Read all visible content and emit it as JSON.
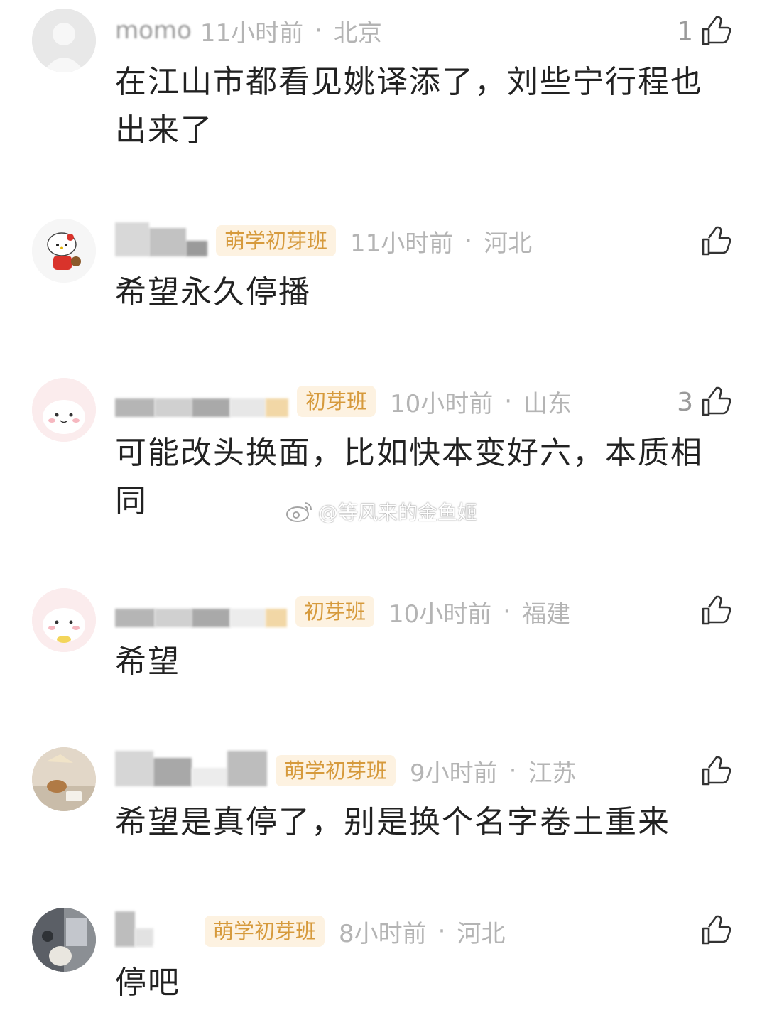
{
  "colors": {
    "badge_bg": "#fdf2e1",
    "badge_text": "#d69a3c",
    "meta_text": "#b4b4b4",
    "body_text": "#222222"
  },
  "comments": [
    {
      "username": "momo",
      "badge": "",
      "time": "11小时前",
      "dot": "·",
      "location": "北京",
      "likes": "1",
      "text": "在江山市都看见姚译添了，刘些宁行程也出来了"
    },
    {
      "username": "",
      "badge": "萌学初芽班",
      "time": "11小时前",
      "dot": "·",
      "location": "河北",
      "likes": "",
      "text": "希望永久停播"
    },
    {
      "username": "",
      "badge": "初芽班",
      "time": "10小时前",
      "dot": "·",
      "location": "山东",
      "likes": "3",
      "text": "可能改头换面，比如快本变好六，本质相同"
    },
    {
      "username": "",
      "badge": "初芽班",
      "time": "10小时前",
      "dot": "·",
      "location": "福建",
      "likes": "",
      "text": "希望"
    },
    {
      "username": "",
      "badge": "萌学初芽班",
      "time": "9小时前",
      "dot": "·",
      "location": "江苏",
      "likes": "",
      "text": "希望是真停了，别是换个名字卷土重来"
    },
    {
      "username": "",
      "badge": "萌学初芽班",
      "time": "8小时前",
      "dot": "·",
      "location": "河北",
      "likes": "",
      "text": "停吧"
    }
  ],
  "watermark": {
    "icon": "weibo-logo-icon",
    "text": "@等风来的金鱼姬"
  }
}
